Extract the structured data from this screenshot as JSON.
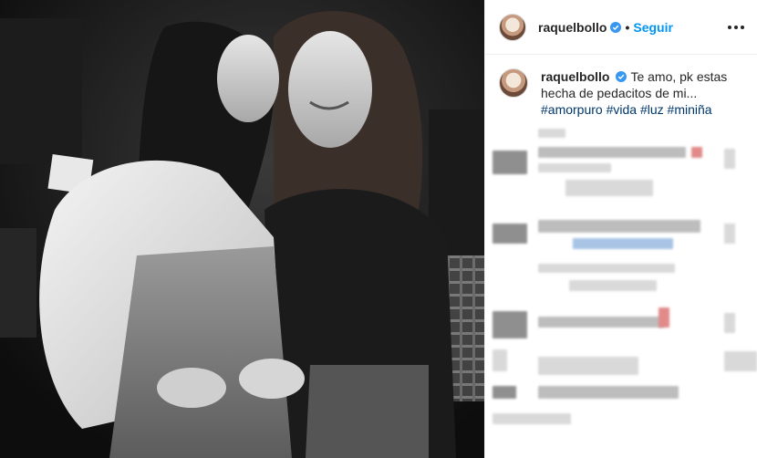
{
  "photo": {
    "alt_icon": "photo-icon"
  },
  "header": {
    "username": "raquelbollo",
    "separator": "•",
    "follow_label": "Seguir",
    "more_icon": "more-options-icon",
    "verified_icon": "verified-badge-icon"
  },
  "caption": {
    "username": "raquelbollo",
    "body": "Te amo, pk estas hecha de pedacitos de mi...",
    "hashtags": [
      "#amorpuro",
      "#vida",
      "#luz",
      "#miniña"
    ]
  },
  "colors": {
    "accent": "#0095f6",
    "hashtag": "#00376b",
    "verified": "#3897f0",
    "text": "#262626"
  }
}
